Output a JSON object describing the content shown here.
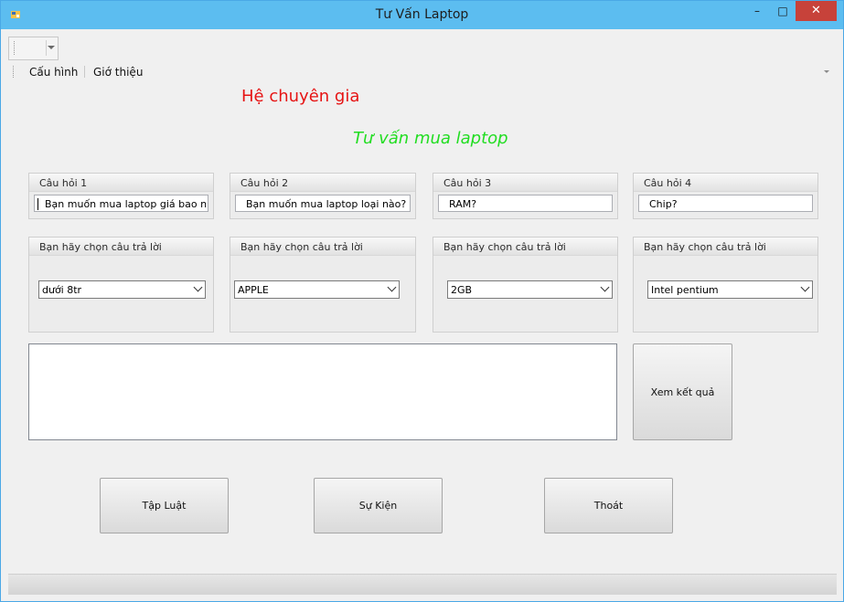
{
  "window": {
    "title": "Tư Vấn Laptop",
    "controls": {
      "minimize": "–",
      "maximize": "□",
      "close": "✕"
    },
    "accent_color": "#5cbdf0",
    "close_color": "#c7423a"
  },
  "menu": {
    "items": [
      {
        "label": "Cấu hình"
      },
      {
        "label": "Giớ thiệu"
      }
    ]
  },
  "headings": {
    "main": "Hệ chuyên gia",
    "sub": "Tư vấn mua laptop",
    "main_color": "#e61414",
    "sub_color": "#22dd22"
  },
  "questions": [
    {
      "title": "Câu hỏi 1",
      "text": "Bạn muốn mua laptop giá bao nhiêu?"
    },
    {
      "title": "Câu hỏi 2",
      "text": "Bạn muốn mua laptop loại nào?"
    },
    {
      "title": "Câu hỏi 3",
      "text": "RAM?"
    },
    {
      "title": "Câu hỏi 4",
      "text": "Chip?"
    }
  ],
  "answers": [
    {
      "title": "Bạn hãy chọn câu trả lời",
      "selected": "dưới 8tr"
    },
    {
      "title": "Bạn hãy chọn câu trả lời",
      "selected": "APPLE"
    },
    {
      "title": "Bạn hãy chọn câu trả lời",
      "selected": "2GB"
    },
    {
      "title": "Bạn hãy chọn câu trả lời",
      "selected": "Intel pentium"
    }
  ],
  "result": {
    "text": ""
  },
  "buttons": {
    "view_result": "Xem kết quả",
    "rules": "Tập Luật",
    "facts": "Sự Kiện",
    "exit": "Thoát"
  }
}
